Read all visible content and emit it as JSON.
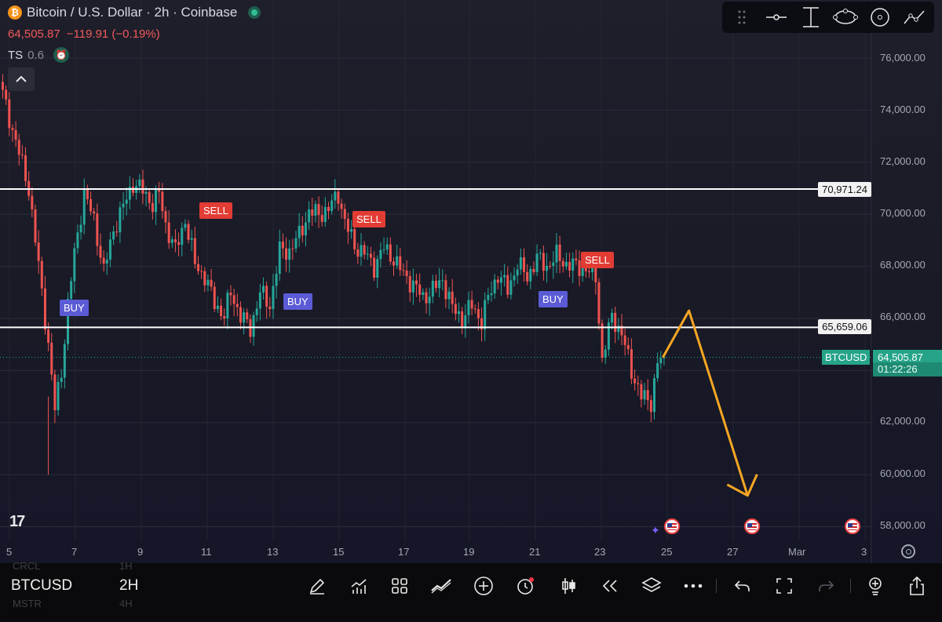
{
  "header": {
    "title": "Bitcoin / U.S. Dollar · 2h · Coinbase",
    "coin_glyph": "₿",
    "last_price": "64,505.87",
    "change": "−119.91 (−0.19%)",
    "indicator_name": "TS",
    "indicator_value": "0.6"
  },
  "drawing_toolbar": {
    "tools": [
      "grip-icon",
      "horizontal-ray-icon",
      "vertical-line-icon",
      "ellipse-icon",
      "circle-icon",
      "path-icon"
    ]
  },
  "price_axis": {
    "labels": [
      "76,000.00",
      "74,000.00",
      "72,000.00",
      "70,000.00",
      "68,000.00",
      "66,000.00",
      "62,000.00",
      "60,000.00",
      "58,000.00"
    ],
    "levels": [
      {
        "value": 70971.24,
        "label": "70,971.24"
      },
      {
        "value": 65659.06,
        "label": "65,659.06"
      }
    ],
    "current": {
      "symbol": "BTCUSD",
      "price": "64,505.87",
      "countdown": "01:22:26"
    }
  },
  "time_axis": {
    "labels": [
      "5",
      "7",
      "9",
      "11",
      "13",
      "15",
      "17",
      "19",
      "21",
      "23",
      "25",
      "27",
      "Mar",
      "3"
    ]
  },
  "signals": [
    {
      "type": "buy",
      "label": "BUY"
    },
    {
      "type": "sell",
      "label": "SELL"
    },
    {
      "type": "buy",
      "label": "BUY"
    },
    {
      "type": "sell",
      "label": "SELL"
    },
    {
      "type": "buy",
      "label": "BUY"
    },
    {
      "type": "sell",
      "label": "SELL"
    }
  ],
  "colors": {
    "up": "#26a69a",
    "down": "#ef5350",
    "buy_badge": "#5b5bd6",
    "sell_badge": "#e23c34",
    "projection": "#f5a623",
    "level_line": "#ffffff"
  },
  "bottom_bar": {
    "symbol": "BTCUSD",
    "interval": "2H",
    "ghost_rows": [
      {
        "symbol": "CRCL",
        "interval": "1H"
      },
      {
        "symbol": "MSTR",
        "interval": "4H"
      }
    ],
    "actions": [
      "pen-icon",
      "indicators-icon",
      "layouts-icon",
      "compare-icon",
      "add-icon",
      "alert-icon",
      "candles-icon",
      "replay-icon",
      "layers-icon",
      "more-icon",
      "undo-icon",
      "fullscreen-icon",
      "redo-icon",
      "ideas-icon",
      "share-icon"
    ]
  },
  "chart_data": {
    "type": "candlestick",
    "symbol": "BTCUSD",
    "interval": "2h",
    "y_range": [
      57000,
      77000
    ],
    "y_ticks": [
      76000,
      74000,
      72000,
      70000,
      68000,
      66000,
      62000,
      60000,
      58000
    ],
    "x_ticks": [
      "5",
      "7",
      "9",
      "11",
      "13",
      "15",
      "17",
      "19",
      "21",
      "23",
      "25",
      "27",
      "Mar",
      "3"
    ],
    "horizontal_levels": [
      70971.24,
      65659.06
    ],
    "current_price": 64505.87,
    "close_path": [
      [
        0,
        74600
      ],
      [
        4,
        72800
      ],
      [
        8,
        71000
      ],
      [
        11,
        68000
      ],
      [
        14,
        65000
      ],
      [
        16,
        62500
      ],
      [
        18,
        64000
      ],
      [
        20,
        66500
      ],
      [
        22,
        68500
      ],
      [
        25,
        70800
      ],
      [
        28,
        69800
      ],
      [
        31,
        67800
      ],
      [
        34,
        69400
      ],
      [
        37,
        70300
      ],
      [
        40,
        71200
      ],
      [
        43,
        70900
      ],
      [
        46,
        70400
      ],
      [
        48,
        70800
      ],
      [
        50,
        69600
      ],
      [
        53,
        68600
      ],
      [
        56,
        69800
      ],
      [
        59,
        68100
      ],
      [
        62,
        67600
      ],
      [
        65,
        66600
      ],
      [
        68,
        66100
      ],
      [
        70,
        67000
      ],
      [
        73,
        66100
      ],
      [
        76,
        65600
      ],
      [
        79,
        67000
      ],
      [
        82,
        66500
      ],
      [
        85,
        68600
      ],
      [
        88,
        68600
      ],
      [
        91,
        69200
      ],
      [
        94,
        70100
      ],
      [
        97,
        70000
      ],
      [
        100,
        70200
      ],
      [
        103,
        70800
      ],
      [
        105,
        69700
      ],
      [
        108,
        68800
      ],
      [
        111,
        68500
      ],
      [
        114,
        68000
      ],
      [
        117,
        68700
      ],
      [
        120,
        68300
      ],
      [
        123,
        67700
      ],
      [
        126,
        67300
      ],
      [
        129,
        66800
      ],
      [
        132,
        67100
      ],
      [
        135,
        67500
      ],
      [
        138,
        66400
      ],
      [
        141,
        66000
      ],
      [
        144,
        66500
      ],
      [
        147,
        65900
      ],
      [
        149,
        66800
      ],
      [
        152,
        67700
      ],
      [
        155,
        67100
      ],
      [
        158,
        68100
      ],
      [
        161,
        67600
      ],
      [
        164,
        68300
      ],
      [
        167,
        68000
      ],
      [
        170,
        68400
      ],
      [
        173,
        68100
      ],
      [
        176,
        68000
      ],
      [
        179,
        67900
      ],
      [
        182,
        67600
      ],
      [
        184,
        64400
      ],
      [
        187,
        66100
      ],
      [
        190,
        65400
      ],
      [
        193,
        64000
      ],
      [
        196,
        63000
      ],
      [
        199,
        62800
      ],
      [
        201,
        64300
      ],
      [
        203,
        64505.87
      ]
    ],
    "signals": [
      {
        "type": "buy",
        "index": 20,
        "price": 65700
      },
      {
        "type": "sell",
        "index": 61,
        "price": 70000
      },
      {
        "type": "buy",
        "index": 86,
        "price": 66000
      },
      {
        "type": "sell",
        "index": 110,
        "price": 69800
      },
      {
        "type": "buy",
        "index": 165,
        "price": 66000
      },
      {
        "type": "sell",
        "index": 182,
        "price": 68000
      }
    ],
    "projection": {
      "description_values": [
        {
          "index": 203,
          "price": 64505.87
        },
        {
          "index": 211,
          "price": 66300
        },
        {
          "index": 229,
          "price": 59200
        }
      ]
    }
  }
}
